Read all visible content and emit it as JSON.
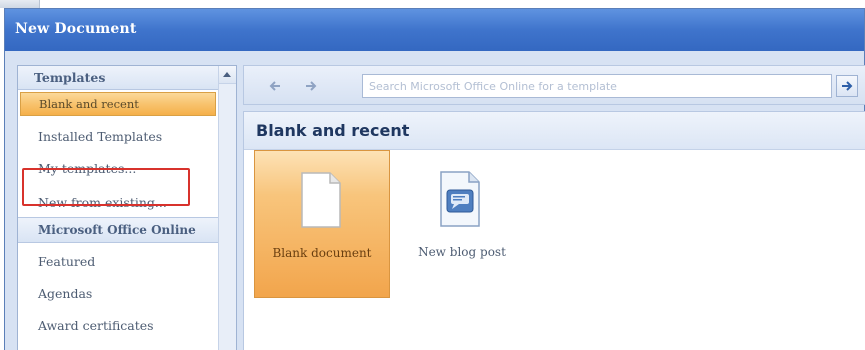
{
  "window": {
    "title": "New Document"
  },
  "sidebar": {
    "header": "Templates",
    "items": [
      {
        "label": "Blank and recent",
        "state": "selected"
      },
      {
        "label": "Installed Templates"
      },
      {
        "label": "My templates..."
      },
      {
        "label": "New from existing..."
      },
      {
        "label": "Microsoft Office Online",
        "type": "group"
      },
      {
        "label": "Featured"
      },
      {
        "label": "Agendas"
      },
      {
        "label": "Award certificates"
      }
    ]
  },
  "toolbar": {
    "back_icon": "back-arrow-icon",
    "forward_icon": "forward-arrow-icon",
    "search_placeholder": "Search Microsoft Office Online for a template",
    "go_icon": "go-arrow-icon"
  },
  "content": {
    "header": "Blank and recent",
    "tiles": [
      {
        "label": "Blank document",
        "icon": "blank-document-icon",
        "state": "selected"
      },
      {
        "label": "New blog post",
        "icon": "blog-post-icon"
      }
    ]
  },
  "colors": {
    "title_bar": "#3f74cc",
    "selection": "#f5b04a",
    "highlight_box": "#d8322c"
  }
}
